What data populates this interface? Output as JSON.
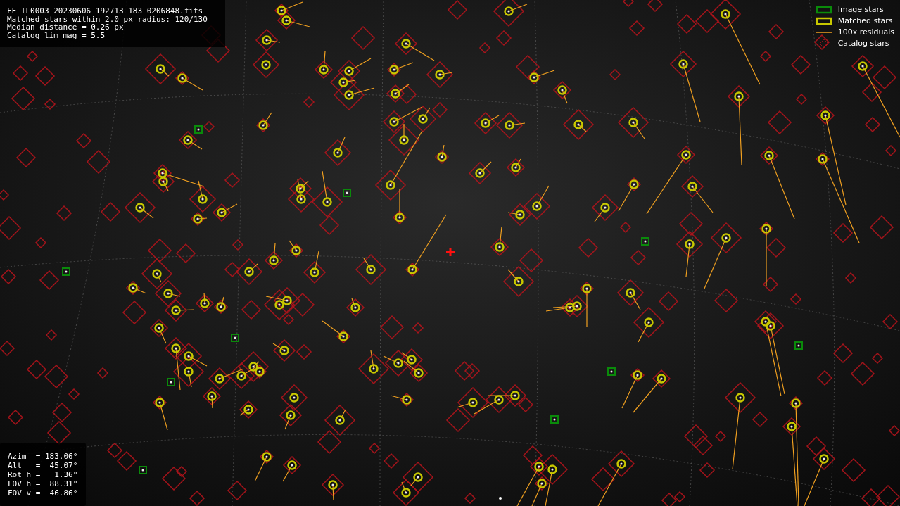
{
  "info_panel": {
    "lines": [
      "FF_IL0003_20230606_192713_183_0206848.fits",
      "Matched stars within 2.0 px radius: 120/130",
      "Median distance = 0.26 px",
      "Catalog lim mag = 5.5"
    ]
  },
  "legend": [
    {
      "kind": "image",
      "label": "Image stars"
    },
    {
      "kind": "matched",
      "label": "Matched stars"
    },
    {
      "kind": "residual",
      "label": "100x residuals"
    },
    {
      "kind": "catalog",
      "label": "Catalog stars"
    }
  ],
  "pointing_panel": {
    "lines": [
      "Azim  = 183.06°",
      "Alt   =  45.07°",
      "Rot h =   1.36°",
      "FOV h =  88.31°",
      "FOV v =  46.86°"
    ]
  }
}
